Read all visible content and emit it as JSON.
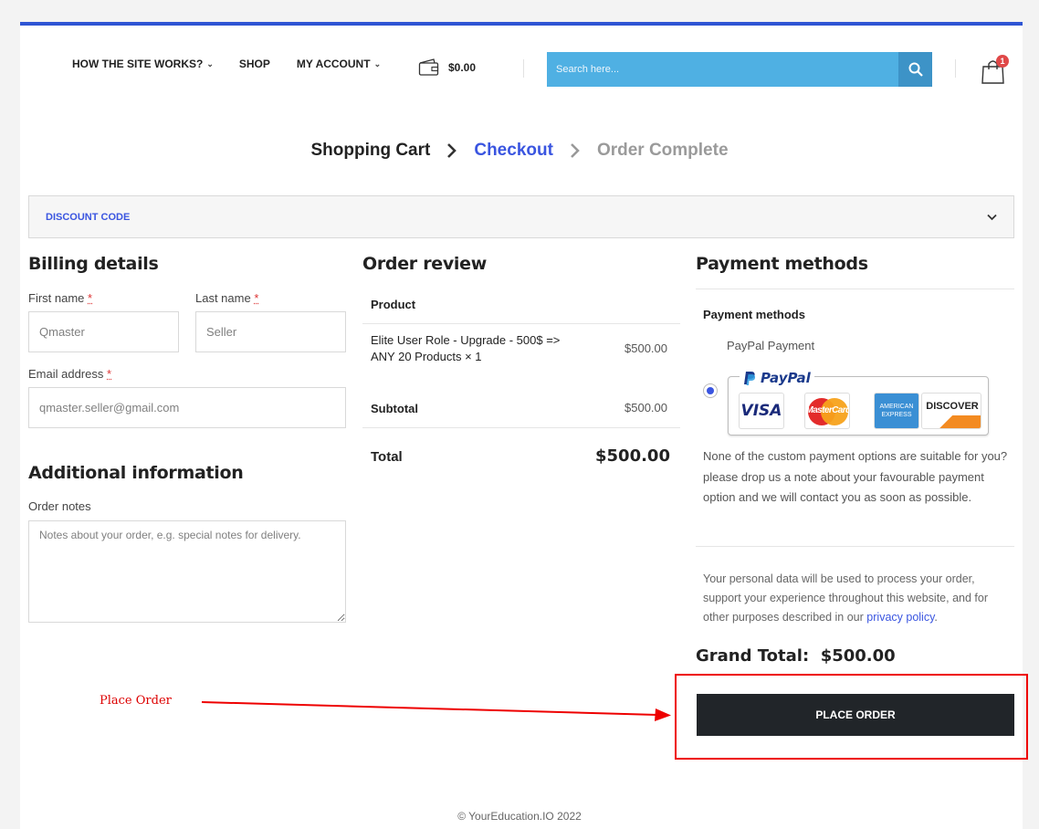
{
  "header": {
    "nav": [
      {
        "label": "HOW THE SITE WORKS?",
        "has_dropdown": true
      },
      {
        "label": "SHOP",
        "has_dropdown": false
      },
      {
        "label": "MY ACCOUNT",
        "has_dropdown": true
      }
    ],
    "wallet_amount": "$0.00",
    "search_placeholder": "Search here...",
    "cart_count": "1"
  },
  "steps": {
    "cart": "Shopping Cart",
    "checkout": "Checkout",
    "complete": "Order Complete"
  },
  "discount": {
    "label": "DISCOUNT CODE"
  },
  "billing": {
    "title": "Billing details",
    "first_name_label": "First name",
    "first_name_placeholder": "Qmaster",
    "last_name_label": "Last name",
    "last_name_placeholder": "Seller",
    "email_label": "Email address",
    "email_placeholder": "qmaster.seller@gmail.com",
    "required_mark": "*"
  },
  "additional": {
    "title": "Additional information",
    "notes_label": "Order notes",
    "notes_placeholder": "Notes about your order, e.g. special notes for delivery."
  },
  "review": {
    "title": "Order review",
    "product_header": "Product",
    "item_line1": "Elite User Role - Upgrade - 500$ =>",
    "item_line2": "ANY 20 Products  × 1",
    "item_price": "$500.00",
    "subtotal_label": "Subtotal",
    "subtotal_value": "$500.00",
    "total_label": "Total",
    "total_value": "$500.00"
  },
  "payment": {
    "title": "Payment methods",
    "subtitle": "Payment methods",
    "method_label": "PayPal Payment",
    "paypal_brand": "PayPal",
    "cards": [
      "VISA",
      "MasterCard",
      "AMERICAN EXPRESS",
      "DISCOVER"
    ],
    "note": "None of the custom payment options are suitable for you? please drop us a note about your favourable payment option and we will contact you as soon as possible.",
    "privacy_text": "Your personal data will be used to process your order, support your experience throughout this website, and for other purposes described in our",
    "privacy_link": "privacy policy",
    "grand_total_label": "Grand Total:",
    "grand_total_value": "$500.00",
    "place_order": "PLACE ORDER"
  },
  "annotation": {
    "text": "Place Order",
    "color": "#dd0000"
  },
  "footer": "© YourEducation.IO 2022",
  "colors": {
    "accent": "#3a55e0",
    "search": "#4fb0e3",
    "button": "#212529"
  }
}
